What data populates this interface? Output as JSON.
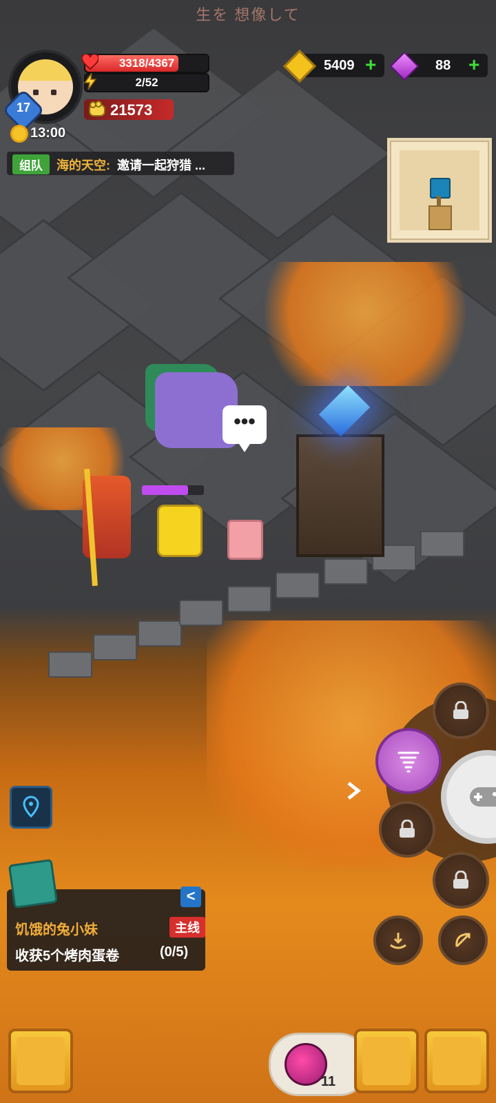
{
  "top_banner": {
    "text": "生を 想像して"
  },
  "player": {
    "level": "17",
    "hp": "3318/4367",
    "hp_fraction": 0.76,
    "stamina": "2/52",
    "power": "21573",
    "time": "13:00"
  },
  "chat": {
    "tag": "组队",
    "name": "海的天空:",
    "message": "邀请一起狩猎 ..."
  },
  "currency": {
    "gold": "5409",
    "gems": "88"
  },
  "speech_bubble": "•••",
  "quest": {
    "title": "饥饿的兔小妹",
    "tag": "主线",
    "description": "收获5个烤肉蛋卷",
    "progress": "(0/5)",
    "collapse_glyph": "<"
  },
  "inventory": {
    "potion_count": "11"
  },
  "icons": {
    "gold": "gold-coin-icon",
    "gem": "purple-gem-icon",
    "lock": "lock-icon",
    "tornado": "tornado-skill-icon",
    "gamepad": "gamepad-icon",
    "location": "location-pin-icon",
    "bow": "bow-icon",
    "dodge": "dodge-icon"
  },
  "colors": {
    "hp": "#d8282a",
    "gold_accent": "#f3c21d",
    "gem_accent": "#a12ac4",
    "team_tag": "#3fa33a",
    "quest_title": "#f2ae3a",
    "quest_tag": "#d72e2e"
  }
}
